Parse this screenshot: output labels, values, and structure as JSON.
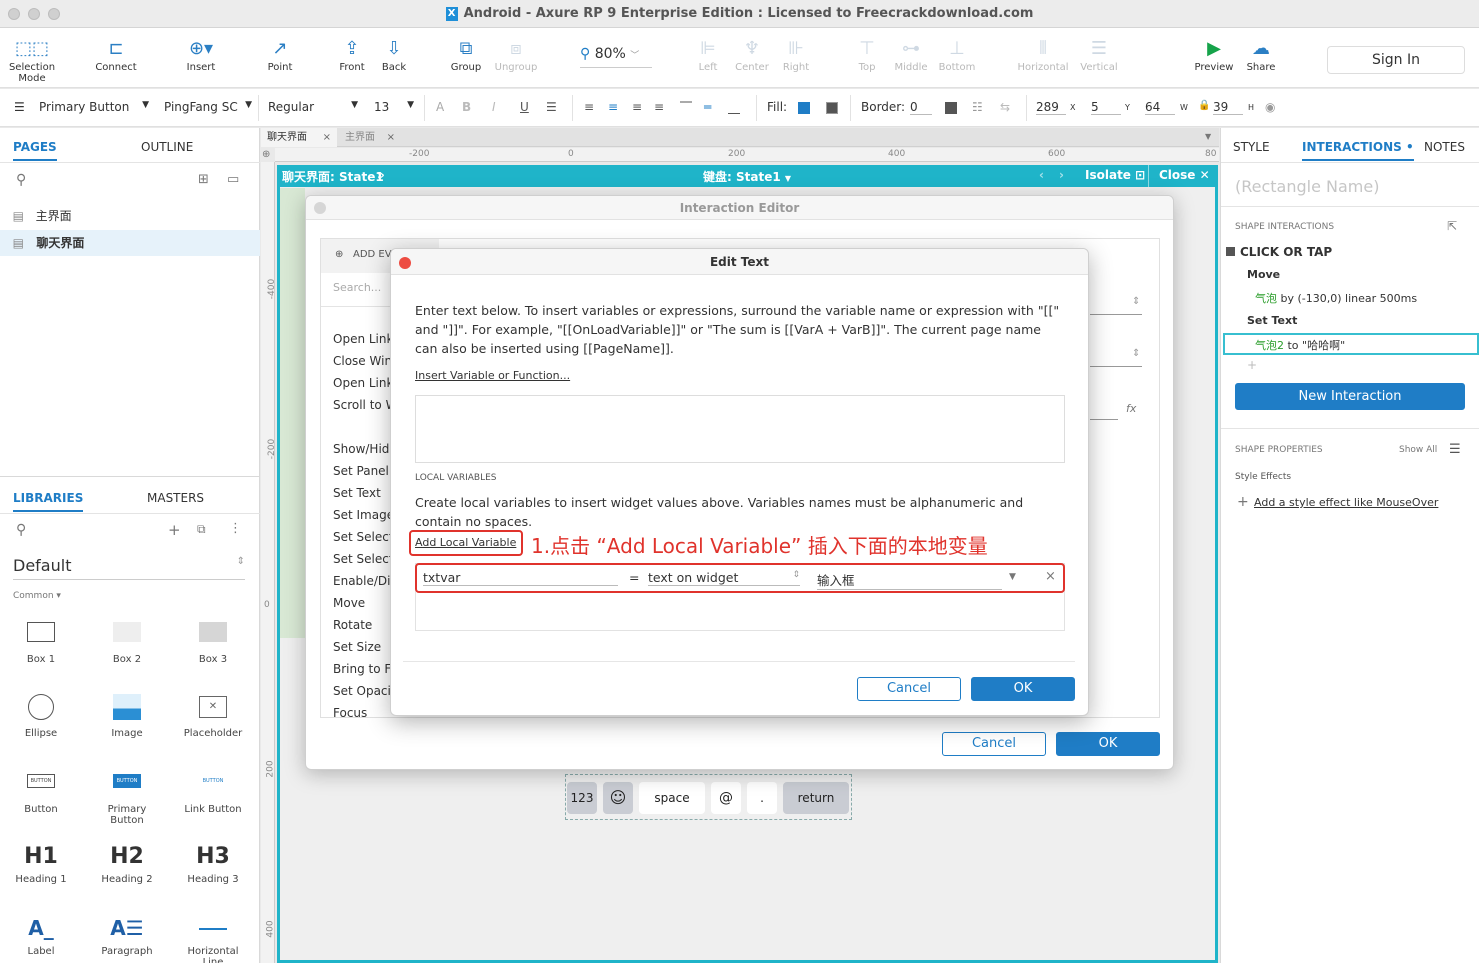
{
  "window": {
    "title": "Android - Axure RP 9 Enterprise Edition : Licensed to Freecrackdownload.com"
  },
  "toolbar": {
    "selection_mode": "Selection Mode",
    "connect": "Connect",
    "insert": "Insert",
    "point": "Point",
    "front": "Front",
    "back": "Back",
    "group": "Group",
    "ungroup": "Ungroup",
    "zoom": "80%",
    "left": "Left",
    "center": "Center",
    "right": "Right",
    "top": "Top",
    "middle": "Middle",
    "bottom": "Bottom",
    "horizontal": "Horizontal",
    "vertical": "Vertical",
    "preview": "Preview",
    "share": "Share",
    "sign_in": "Sign In"
  },
  "format": {
    "style": "Primary Button",
    "font": "PingFang SC",
    "weight": "Regular",
    "size": "13",
    "fill_label": "Fill:",
    "border_label": "Border:",
    "border_value": "0",
    "x": "289",
    "x_label": "X",
    "y": "5",
    "y_label": "Y",
    "w": "64",
    "w_label": "W",
    "h": "39",
    "h_label": "H"
  },
  "left": {
    "pages_tab": "PAGES",
    "outline_tab": "OUTLINE",
    "pages": [
      "主界面",
      "聊天界面"
    ],
    "libraries_tab": "LIBRARIES",
    "masters_tab": "MASTERS",
    "library": "Default",
    "common": "Common ▾",
    "widgets": [
      "Box 1",
      "Box 2",
      "Box 3",
      "Ellipse",
      "Image",
      "Placeholder",
      "Button",
      "Primary Button",
      "Link Button",
      "Heading 1",
      "Heading 2",
      "Heading 3",
      "Label",
      "Paragraph",
      "Horizontal Line"
    ],
    "btn_glyph": "BUTTON",
    "h1": "H1",
    "h2": "H2",
    "h3": "H3",
    "label_glyph": "A_"
  },
  "canvas": {
    "tab1": "聊天界面",
    "tab2": "主界面",
    "state_label": "聊天界面: State1",
    "kb_state": "键盘:  State1",
    "isolate": "Isolate",
    "close": "Close",
    "ruler": [
      "-200",
      "0",
      "200",
      "400",
      "600",
      "80"
    ],
    "vruler": [
      "-400",
      "-200",
      "0",
      "200",
      "400"
    ],
    "keys": [
      "123",
      "☺",
      "space",
      "@",
      ".",
      "return"
    ]
  },
  "interaction_editor": {
    "title": "Interaction Editor",
    "add_event": "ADD EV",
    "search": "Search...",
    "actions": [
      "Open Link",
      "Close Win",
      "Open Link",
      "Scroll to W",
      "Show/Hide",
      "Set Panel S",
      "Set Text",
      "Set Image",
      "Set Selecte",
      "Set Selecte",
      "Enable/Dis",
      "Move",
      "Rotate",
      "Set Size",
      "Bring to Fr",
      "Set Opacit",
      "Focus"
    ],
    "cancel": "Cancel",
    "ok": "OK",
    "fx": "fx"
  },
  "edit_text": {
    "title": "Edit Text",
    "instructions": "Enter text below. To insert variables or expressions, surround the variable name or expression with \"[[\" and \"]]\". For example, \"[[OnLoadVariable]]\" or \"The sum is [[VarA + VarB]]\". The current page name can also be inserted using [[PageName]].",
    "insert_link": "Insert Variable or Function...",
    "local_vars_header": "LOCAL VARIABLES",
    "local_vars_desc": "Create local variables to insert widget values above. Variables names must be alphanumeric and contain no spaces.",
    "add_local": "Add Local Variable",
    "annotation": "1.点击 “Add Local Variable” 插入下面的本地变量",
    "var_name": "txtvar",
    "equals": "=",
    "var_type": "text on widget",
    "var_target": "输入框",
    "cancel": "Cancel",
    "ok": "OK"
  },
  "right": {
    "style_tab": "STYLE",
    "interactions_tab": "INTERACTIONS",
    "notes_tab": "NOTES",
    "rect_name": "(Rectangle Name)",
    "shape_interactions": "SHAPE INTERACTIONS",
    "click_or_tap": "CLICK OR TAP",
    "move": "Move",
    "move_target": "气泡",
    "move_detail": " by (-130,0) linear 500ms",
    "set_text": "Set Text",
    "set_text_target": "气泡2",
    "set_text_detail": " to \"哈哈啊\"",
    "new_interaction": "New Interaction",
    "shape_properties": "SHAPE PROPERTIES",
    "show_all": "Show All",
    "style_effects": "Style Effects",
    "add_style_effect": "Add a style effect like MouseOver"
  },
  "colors": {
    "accent": "#1f7dc6",
    "state": "#1fb4c9",
    "annotation": "#e0332c",
    "green": "#2a9d2a"
  }
}
